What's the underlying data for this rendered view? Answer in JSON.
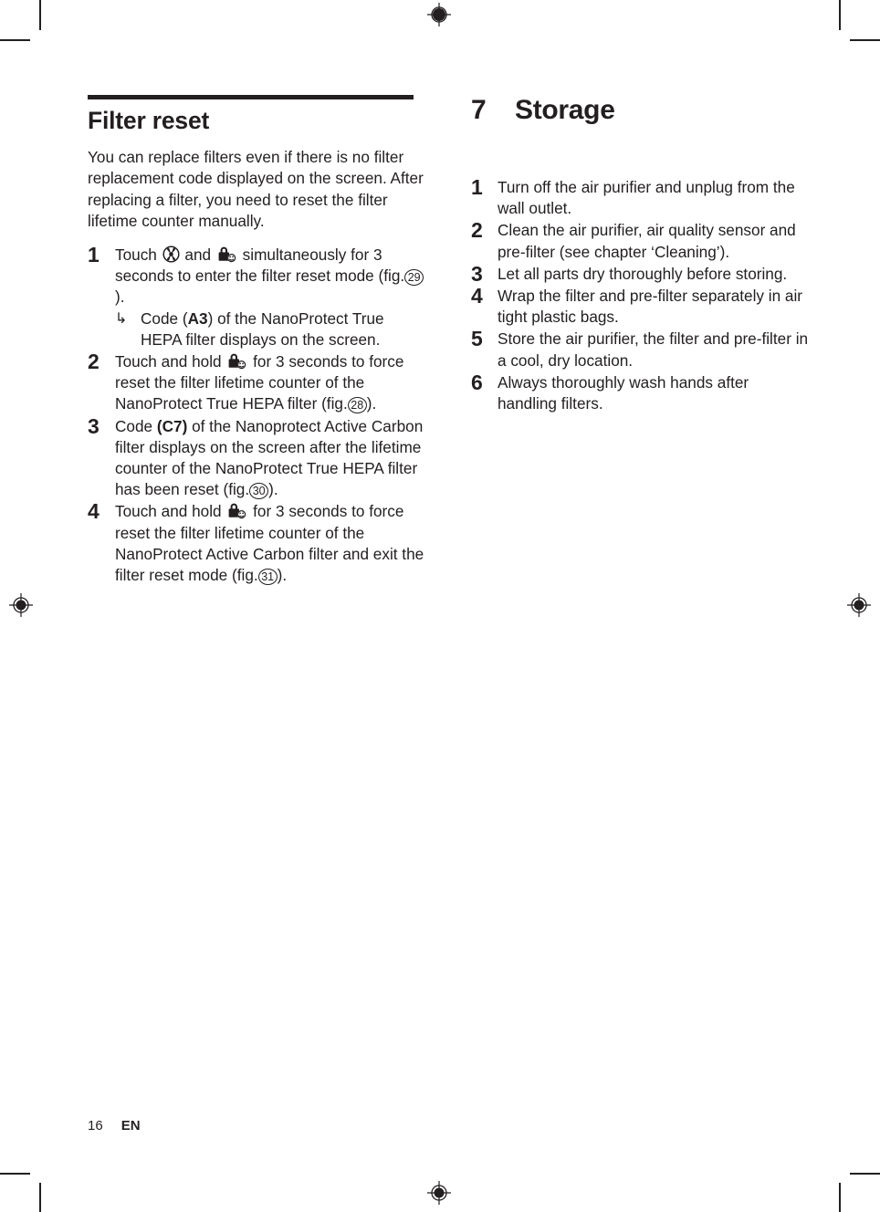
{
  "document": {
    "page_number": "16",
    "language_code": "EN"
  },
  "left_column": {
    "section_title": "Filter reset",
    "intro": "You can replace filters even if there is no filter replacement code displayed on the screen. After replacing a filter, you need to reset the filter lifetime counter manually.",
    "steps": [
      {
        "number": "1",
        "text_before_icon1": "Touch ",
        "icon1": "fan-cross-circle-icon",
        "text_between_icons": " and ",
        "icon2": "child-lock-icon",
        "text_after_icons": " simultaneously for 3 seconds to enter the filter reset mode (fig.",
        "fig": "29",
        "text_tail": ").",
        "substep": {
          "arrow": "↳",
          "prefix": "Code (",
          "code": "A3",
          "suffix": ") of the NanoProtect True HEPA filter displays on the screen."
        }
      },
      {
        "number": "2",
        "text_before_icon": "Touch and hold ",
        "icon": "child-lock-icon",
        "text_after_icon": " for 3 seconds to force reset the filter lifetime counter of the NanoProtect True HEPA filter (fig.",
        "fig": "28",
        "text_tail": ")."
      },
      {
        "number": "3",
        "prefix": "Code ",
        "code": "(C7)",
        "suffix": " of the Nanoprotect Active Carbon filter displays on the screen after the lifetime counter of the NanoProtect True HEPA filter has been reset (fig.",
        "fig": "30",
        "text_tail": ")."
      },
      {
        "number": "4",
        "text_before_icon": "Touch and hold ",
        "icon": "child-lock-icon",
        "text_after_icon": " for 3 seconds to force reset the filter lifetime counter of the NanoProtect Active Carbon filter and exit the filter reset mode (fig.",
        "fig": "31",
        "text_tail": ")."
      }
    ]
  },
  "right_column": {
    "chapter_number": "7",
    "chapter_title": "Storage",
    "steps": [
      {
        "number": "1",
        "text": "Turn off the air purifier and unplug from the wall outlet."
      },
      {
        "number": "2",
        "text": "Clean the air purifier, air quality sensor and pre-filter (see chapter ‘Cleaning’)."
      },
      {
        "number": "3",
        "text": "Let all parts dry thoroughly before storing."
      },
      {
        "number": "4",
        "text": "Wrap the filter and pre-filter separately in air tight plastic bags."
      },
      {
        "number": "5",
        "text": "Store the air purifier, the filter and pre-filter in a cool, dry location."
      },
      {
        "number": "6",
        "text": "Always thoroughly wash hands after handling filters."
      }
    ]
  },
  "print_marks": {
    "registration_marks": [
      "top-center",
      "left-middle",
      "right-middle",
      "bottom-center"
    ],
    "crop_marks": [
      "top-left",
      "top-right",
      "bottom-left",
      "bottom-right"
    ],
    "ink_color": "#231f20"
  }
}
